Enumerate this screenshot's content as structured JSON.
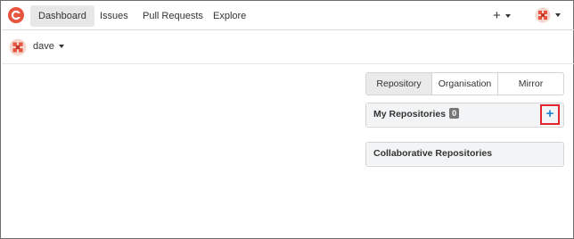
{
  "nav": {
    "items": [
      {
        "label": "Dashboard",
        "active": true
      },
      {
        "label": "Issues",
        "active": false
      },
      {
        "label": "Pull Requests",
        "active": false
      },
      {
        "label": "Explore",
        "active": false
      }
    ],
    "create_symbol": "+"
  },
  "context": {
    "username": "dave"
  },
  "tabs": [
    {
      "label": "Repository",
      "active": true
    },
    {
      "label": "Organisation",
      "active": false
    },
    {
      "label": "Mirror",
      "active": false
    }
  ],
  "panels": {
    "my_repos": {
      "title": "My Repositories",
      "count": "0",
      "add_symbol": "+"
    },
    "collab": {
      "title": "Collaborative Repositories"
    }
  },
  "colors": {
    "logo": "#e8553e",
    "active_bg": "#e7e7e7",
    "panel_head_bg": "#f3f4f5",
    "badge_bg": "#767676",
    "add_icon": "#2185d0",
    "highlight": "#e3262d"
  },
  "icons": {
    "logo": "gitea-style-logo-icon",
    "avatar": "identicon-avatar",
    "create": "plus-icon",
    "caret": "caret-down-icon",
    "add_repo": "plus-icon"
  }
}
